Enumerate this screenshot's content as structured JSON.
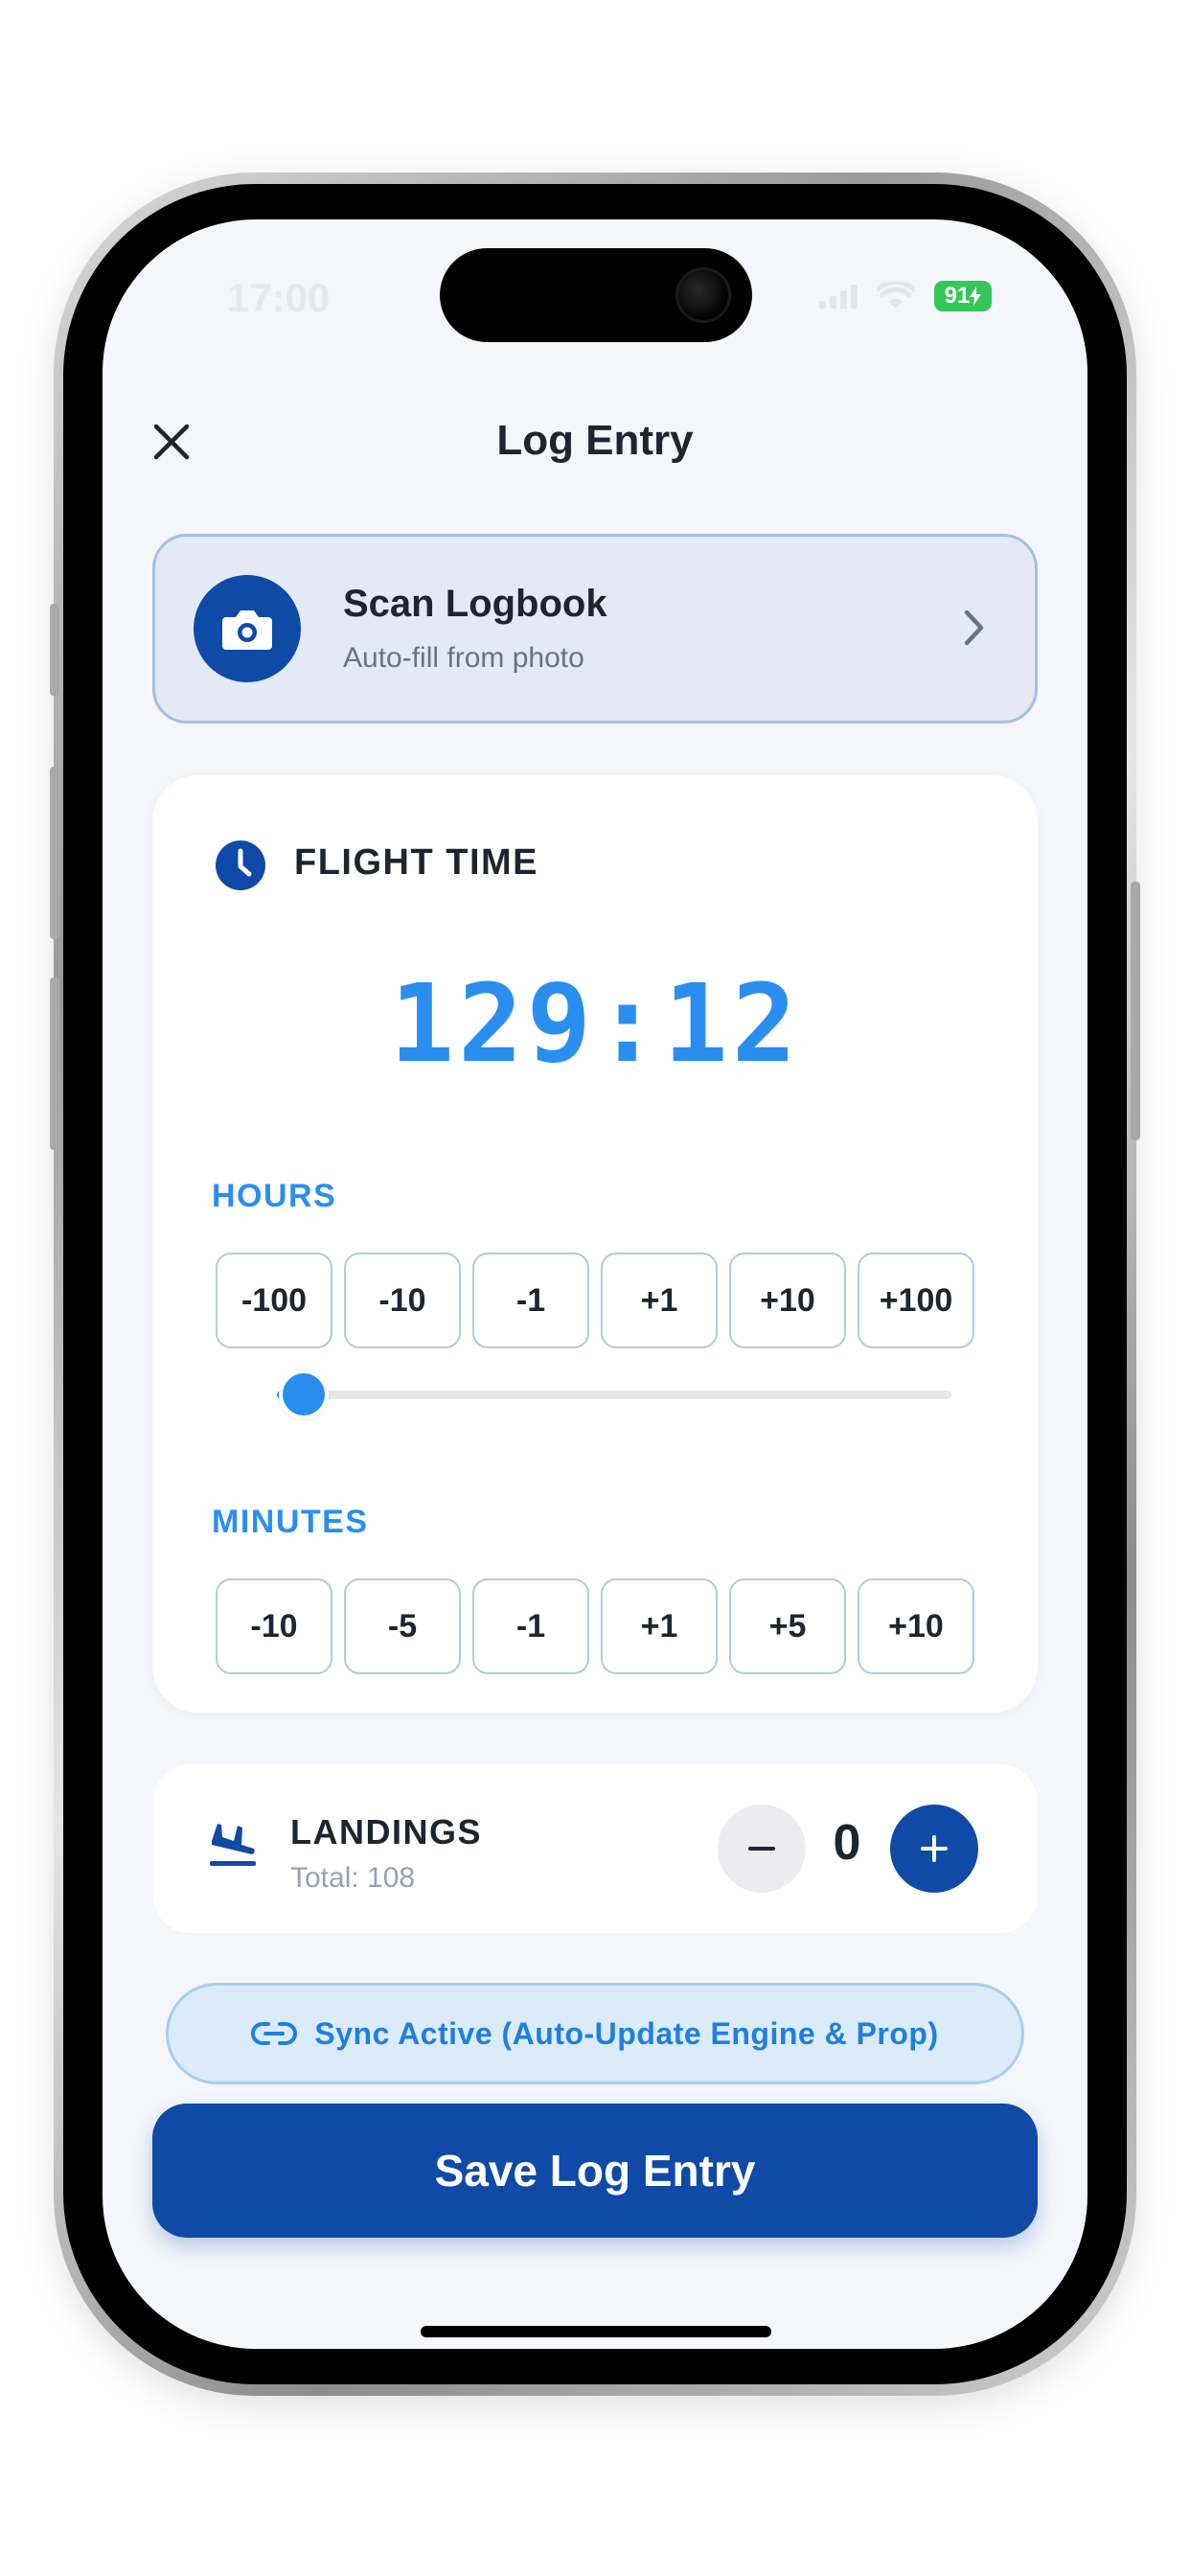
{
  "status_bar": {
    "time": "17:00",
    "battery": "91"
  },
  "header": {
    "title": "Log Entry",
    "close_icon": "close-icon"
  },
  "scan_card": {
    "title": "Scan Logbook",
    "subtitle": "Auto-fill from photo",
    "icon": "camera-icon"
  },
  "flight_time": {
    "title": "FLIGHT TIME",
    "icon": "clock-icon",
    "value": "129:12",
    "hours_label": "HOURS",
    "hours_buttons": [
      "-100",
      "-10",
      "-1",
      "+1",
      "+10",
      "+100"
    ],
    "hours_slider_fraction": 0.04,
    "minutes_label": "MINUTES",
    "minutes_buttons": [
      "-10",
      "-5",
      "-1",
      "+1",
      "+5",
      "+10"
    ]
  },
  "landings": {
    "title": "LANDINGS",
    "total": "Total: 108",
    "count": "0",
    "icon": "airplane-landing-icon"
  },
  "sync": {
    "label": "Sync Active (Auto-Update Engine & Prop)",
    "icon": "link-icon"
  },
  "save_button": {
    "label": "Save Log Entry"
  },
  "colors": {
    "primary": "#0f4aa6",
    "accent": "#2a8ef0",
    "background": "#f4f6fb"
  }
}
